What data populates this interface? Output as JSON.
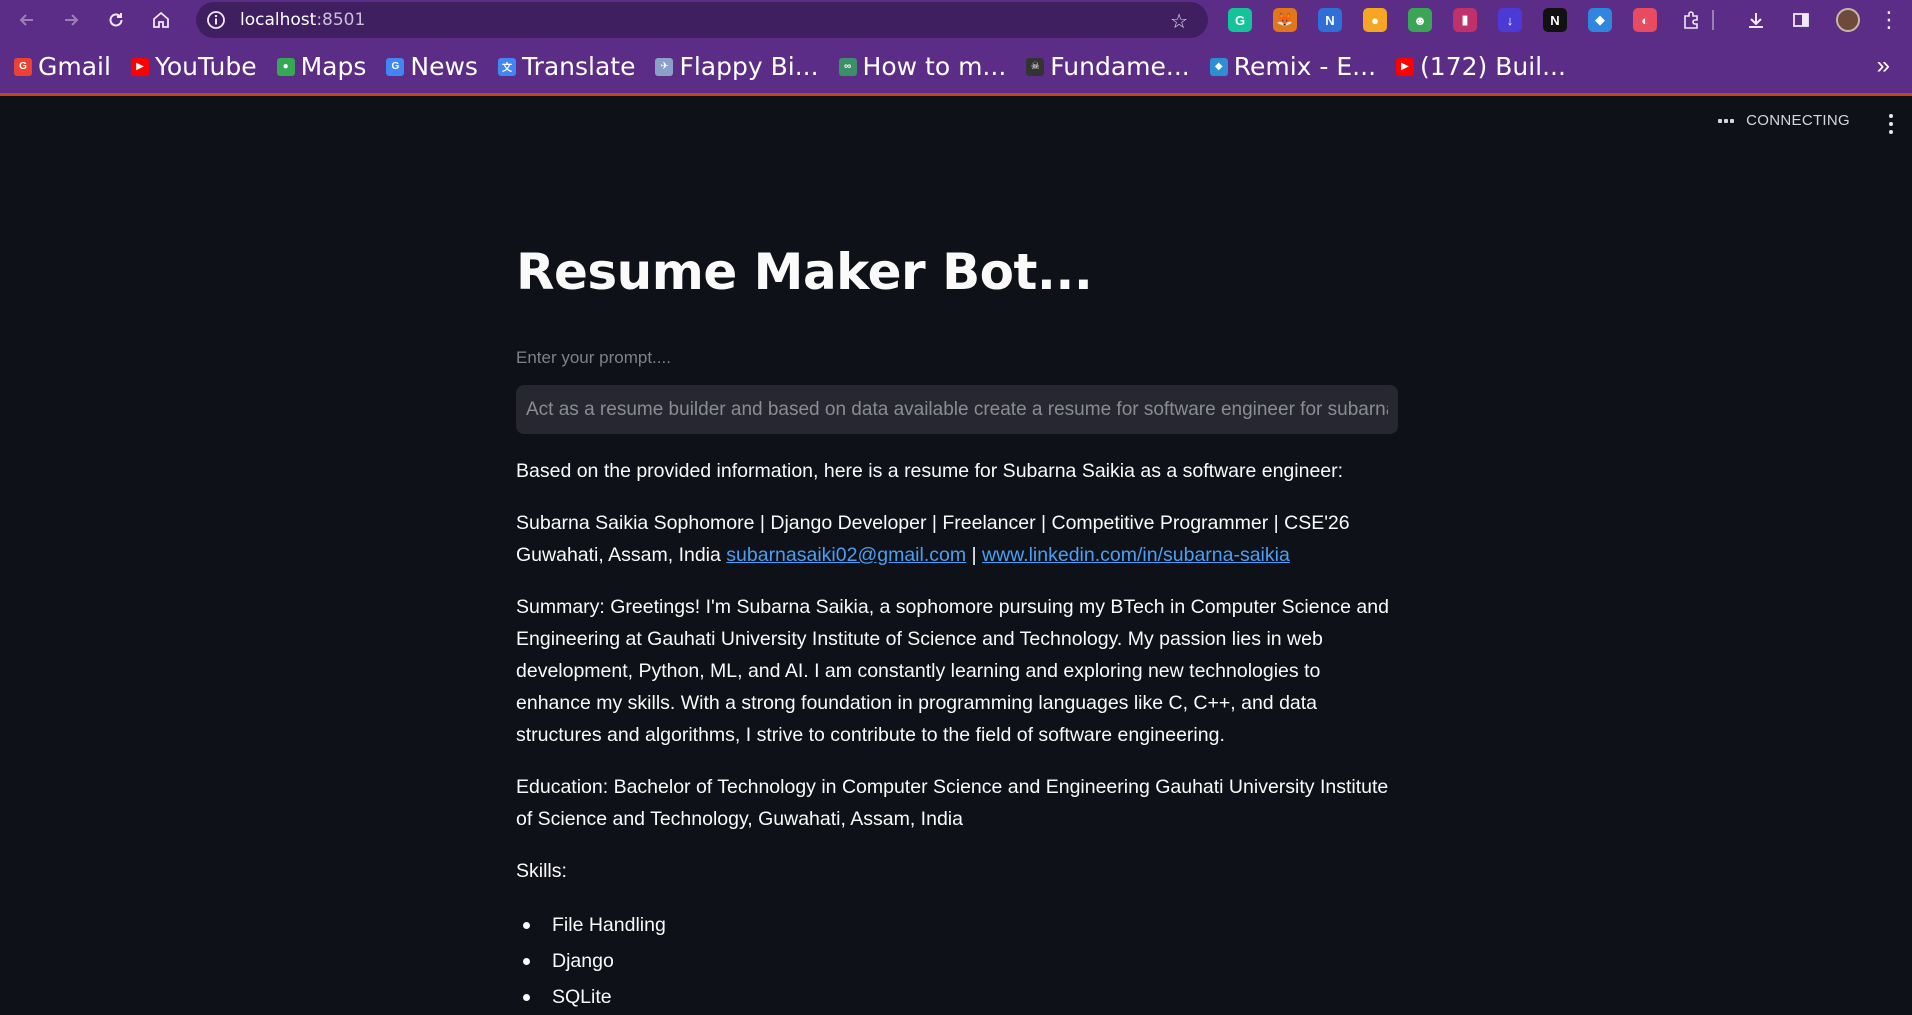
{
  "browser": {
    "url_host": "localhost",
    "url_port": ":8501",
    "extensions": [
      {
        "name": "grammarly-icon",
        "glyph": "G",
        "color": "#15c39a"
      },
      {
        "name": "metamask-icon",
        "glyph": "🦊",
        "color": "#e2761b"
      },
      {
        "name": "extension-n-icon",
        "glyph": "N",
        "color": "#2f6fd6"
      },
      {
        "name": "extension-coin-icon",
        "glyph": "●",
        "color": "#f5a623"
      },
      {
        "name": "extension-bot-icon",
        "glyph": "☻",
        "color": "#3aa655"
      },
      {
        "name": "extension-chart-icon",
        "glyph": "▮",
        "color": "#c0306b"
      },
      {
        "name": "extension-download-icon",
        "glyph": "↓",
        "color": "#4b3ad6"
      },
      {
        "name": "notion-icon",
        "glyph": "N",
        "color": "#111111"
      },
      {
        "name": "extension-gem-icon",
        "glyph": "◆",
        "color": "#2e86de"
      },
      {
        "name": "extension-colorful-icon",
        "glyph": "◐",
        "color": "#e84a5f"
      }
    ]
  },
  "bookmarks": [
    {
      "label": "Gmail",
      "icon": "gmail-icon",
      "color": "#ea4335",
      "glyph": "G"
    },
    {
      "label": "YouTube",
      "icon": "youtube-icon",
      "color": "#ff0000",
      "glyph": "▶"
    },
    {
      "label": "Maps",
      "icon": "maps-icon",
      "color": "#34a853",
      "glyph": "●"
    },
    {
      "label": "News",
      "icon": "news-icon",
      "color": "#4285f4",
      "glyph": "G"
    },
    {
      "label": "Translate",
      "icon": "translate-icon",
      "color": "#4285f4",
      "glyph": "文"
    },
    {
      "label": "Flappy Bi...",
      "icon": "flappy-bird-icon",
      "color": "#8aa0c8",
      "glyph": "✈"
    },
    {
      "label": "How to m...",
      "icon": "how-to-icon",
      "color": "#3d8f6a",
      "glyph": "∞"
    },
    {
      "label": "Fundame...",
      "icon": "fundamentals-icon",
      "color": "#333333",
      "glyph": "☠"
    },
    {
      "label": "Remix - E...",
      "icon": "remix-icon",
      "color": "#2e8fd0",
      "glyph": "◆"
    },
    {
      "label": "(172) Buil...",
      "icon": "youtube-icon",
      "color": "#ff0000",
      "glyph": "▶"
    }
  ],
  "app": {
    "status": "CONNECTING",
    "title": "Resume Maker Bot...",
    "prompt_label": "Enter your prompt....",
    "prompt_value": "Act as a resume builder and based on data available create a resume for software engineer for subarna s",
    "intro": "Based on the provided information, here is a resume for Subarna Saikia as a software engineer:",
    "header_text": "Subarna Saikia Sophomore | Django Developer | Freelancer | Competitive Programmer | CSE'26 Guwahati, Assam, India ",
    "email": "subarnasaiki02@gmail.com",
    "separator": " | ",
    "linkedin": "www.linkedin.com/in/subarna-saikia",
    "summary": "Summary: Greetings! I'm Subarna Saikia, a sophomore pursuing my BTech in Computer Science and Engineering at Gauhati University Institute of Science and Technology. My passion lies in web development, Python, ML, and AI. I am constantly learning and exploring new technologies to enhance my skills. With a strong foundation in programming languages like C, C++, and data structures and algorithms, I strive to contribute to the field of software engineering.",
    "education": "Education: Bachelor of Technology in Computer Science and Engineering Gauhati University Institute of Science and Technology, Guwahati, Assam, India",
    "skills_label": "Skills:",
    "skills": [
      "File Handling",
      "Django",
      "SQLite"
    ]
  }
}
